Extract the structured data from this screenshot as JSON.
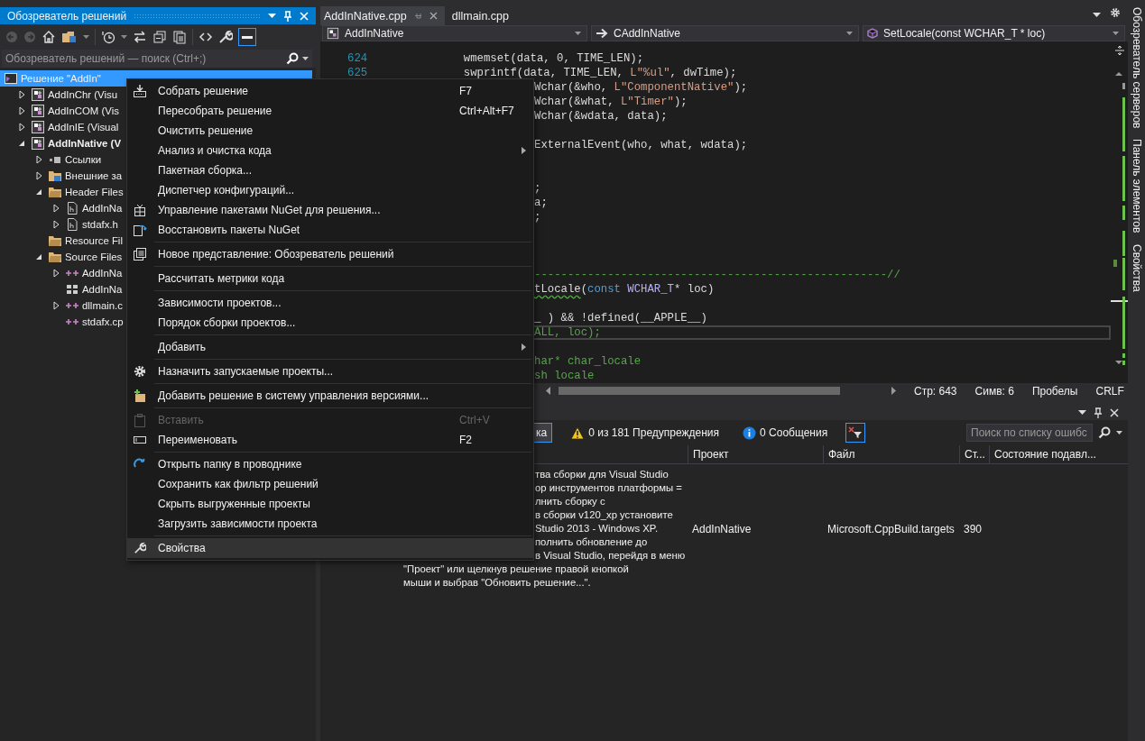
{
  "solution_explorer": {
    "title": "Обозреватель решений",
    "search": {
      "placeholder": "Обозреватель решений — поиск (Ctrl+;)"
    },
    "tree": [
      {
        "label": "Решение \"AddIn\"",
        "kind": "solution",
        "selected": true,
        "children": [
          {
            "label": "AddInChr (Visu",
            "kind": "project",
            "expanded": false,
            "startup": false,
            "selected": false
          },
          {
            "label": "AddInCOM (Vis",
            "kind": "project",
            "expanded": false,
            "startup": false,
            "selected": false
          },
          {
            "label": "AddInIE (Visual",
            "kind": "project",
            "expanded": false,
            "startup": false,
            "selected": false
          },
          {
            "label": "AddInNative (V",
            "kind": "project",
            "expanded": true,
            "startup": true,
            "selected": false,
            "children": [
              {
                "label": "Ссылки",
                "kind": "references",
                "expanded": false,
                "selected": false
              },
              {
                "label": "Внешние за",
                "kind": "external",
                "expanded": false,
                "selected": false
              },
              {
                "label": "Header Files",
                "kind": "folder",
                "expanded": true,
                "selected": false,
                "children": [
                  {
                    "label": "AddInNa",
                    "kind": "header",
                    "expanded": false,
                    "selected": false
                  },
                  {
                    "label": "stdafx.h",
                    "kind": "header",
                    "expanded": false,
                    "selected": false
                  }
                ]
              },
              {
                "label": "Resource Fil",
                "kind": "folder",
                "selected": false
              },
              {
                "label": "Source Files",
                "kind": "folder",
                "expanded": true,
                "selected": false,
                "children": [
                  {
                    "label": "AddInNa",
                    "kind": "cpp",
                    "expanded": false,
                    "selected": false
                  },
                  {
                    "label": "AddInNa",
                    "kind": "def",
                    "selected": false
                  },
                  {
                    "label": "dllmain.c",
                    "kind": "cpp",
                    "expanded": false,
                    "selected": false
                  },
                  {
                    "label": "stdafx.cp",
                    "kind": "cpp",
                    "selected": false
                  }
                ]
              }
            ]
          }
        ]
      }
    ]
  },
  "editor": {
    "tabs": [
      {
        "label": "AddInNative.cpp",
        "selected": true
      },
      {
        "label": "dllmain.cpp",
        "selected": false
      }
    ],
    "navigation": [
      {
        "label": "AddInNative",
        "kind": "project"
      },
      {
        "label": "CAddInNative",
        "kind": "class"
      },
      {
        "label": "SetLocale(const WCHAR_T * loc)",
        "kind": "method"
      }
    ],
    "lines": [
      {
        "kind": "numbered",
        "number": "624",
        "tokens": [
          {
            "text": "          wmemset(data, 0, TIME_LEN);",
            "kind": "plain"
          }
        ]
      },
      {
        "kind": "numbered",
        "number": "625",
        "tokens": [
          {
            "text": "          swprintf(data, TIME_LEN, ",
            "kind": "plain"
          },
          {
            "text": "L\"%ul\"",
            "kind": "string"
          },
          {
            "text": ", dwTime);",
            "kind": "plain"
          }
        ]
      },
      {
        "kind": "covered",
        "tokens": [
          {
            "text": "Wchar(&who, ",
            "kind": "plain"
          },
          {
            "text": "L\"ComponentNative\"",
            "kind": "string"
          },
          {
            "text": ");",
            "kind": "plain"
          }
        ]
      },
      {
        "kind": "covered",
        "tokens": [
          {
            "text": "Wchar(&what, ",
            "kind": "plain"
          },
          {
            "text": "L\"Timer\"",
            "kind": "string"
          },
          {
            "text": ");",
            "kind": "plain"
          }
        ]
      },
      {
        "kind": "covered",
        "tokens": [
          {
            "text": "Wchar(&wdata, data);",
            "kind": "plain"
          }
        ]
      },
      {
        "kind": "blank"
      },
      {
        "kind": "covered",
        "tokens": [
          {
            "text": "ExternalEvent(who, what, wdata);",
            "kind": "plain"
          }
        ]
      },
      {
        "kind": "blank"
      },
      {
        "kind": "blank"
      },
      {
        "kind": "covered",
        "tokens": [
          {
            "text": ";",
            "kind": "plain"
          }
        ]
      },
      {
        "kind": "covered",
        "tokens": [
          {
            "text": "a;",
            "kind": "plain"
          }
        ]
      },
      {
        "kind": "covered",
        "tokens": [
          {
            "text": ";",
            "kind": "plain"
          }
        ]
      },
      {
        "kind": "blank"
      },
      {
        "kind": "blank"
      },
      {
        "kind": "blank"
      },
      {
        "kind": "covered",
        "tokens": [
          {
            "text": "-----------------------------------------------------//",
            "kind": "comment"
          }
        ]
      },
      {
        "kind": "covered",
        "tokens": [
          {
            "text": "tLocale",
            "kind": "plain",
            "squiggle": true
          },
          {
            "text": "(",
            "kind": "plain"
          },
          {
            "text": "const",
            "kind": "keyword"
          },
          {
            "text": " WCHAR_T",
            "kind": "type"
          },
          {
            "text": "* loc)",
            "kind": "plain"
          }
        ]
      },
      {
        "kind": "blank"
      },
      {
        "kind": "covered",
        "tokens": [
          {
            "text": "_ ) && !defined(__APPLE__)",
            "kind": "plain"
          }
        ]
      },
      {
        "kind": "covered",
        "current": true,
        "tokens": [
          {
            "text": "ALL, loc);",
            "kind": "comment"
          }
        ]
      },
      {
        "kind": "blank"
      },
      {
        "kind": "covered",
        "tokens": [
          {
            "text": "har* char_locale",
            "kind": "comment"
          }
        ]
      },
      {
        "kind": "covered",
        "tokens": [
          {
            "text": "sh locale",
            "kind": "comment"
          }
        ]
      }
    ],
    "status": {
      "line": "Стр: 643",
      "column": "Симв: 6",
      "indent": "Пробелы",
      "line_endings": "CRLF"
    }
  },
  "context_menu": {
    "groups": [
      [
        {
          "label": "Собрать решение",
          "shortcut": "F7",
          "kind": "build",
          "selected": false,
          "disabled": false
        },
        {
          "label": "Пересобрать решение",
          "shortcut": "Ctrl+Alt+F7",
          "selected": false,
          "disabled": false
        },
        {
          "label": "Очистить решение",
          "selected": false,
          "disabled": false
        },
        {
          "label": "Анализ и очистка кода",
          "submenu": true,
          "selected": false,
          "disabled": false
        },
        {
          "label": "Пакетная сборка...",
          "selected": false,
          "disabled": false
        },
        {
          "label": "Диспетчер конфигураций...",
          "selected": false,
          "disabled": false
        },
        {
          "label": "Управление пакетами NuGet для решения...",
          "kind": "nuget",
          "selected": false,
          "disabled": false
        },
        {
          "label": "Восстановить пакеты NuGet",
          "kind": "restore",
          "selected": false,
          "disabled": false
        }
      ],
      [
        {
          "label": "Новое представление: Обозреватель решений",
          "kind": "view",
          "selected": false,
          "disabled": false
        }
      ],
      [
        {
          "label": "Рассчитать метрики кода",
          "selected": false,
          "disabled": false
        }
      ],
      [
        {
          "label": "Зависимости проектов...",
          "selected": false,
          "disabled": false
        },
        {
          "label": "Порядок сборки проектов...",
          "selected": false,
          "disabled": false
        }
      ],
      [
        {
          "label": "Добавить",
          "submenu": true,
          "selected": false,
          "disabled": false
        }
      ],
      [
        {
          "label": "Назначить запускаемые проекты...",
          "kind": "gear",
          "selected": false,
          "disabled": false
        }
      ],
      [
        {
          "label": "Добавить решение в систему управления версиями...",
          "kind": "vcs",
          "selected": false,
          "disabled": false
        }
      ],
      [
        {
          "label": "Вставить",
          "shortcut": "Ctrl+V",
          "kind": "paste",
          "selected": false,
          "disabled": true
        },
        {
          "label": "Переименовать",
          "shortcut": "F2",
          "kind": "rename",
          "selected": false,
          "disabled": false
        }
      ],
      [
        {
          "label": "Открыть папку в проводнике",
          "kind": "folder",
          "selected": false,
          "disabled": false
        },
        {
          "label": "Сохранить как фильтр решений",
          "selected": false,
          "disabled": false
        },
        {
          "label": "Скрыть выгруженные проекты",
          "selected": false,
          "disabled": false
        },
        {
          "label": "Загрузить зависимости проекта",
          "selected": false,
          "disabled": false
        }
      ],
      [
        {
          "label": "Свойства",
          "kind": "wrench",
          "selected": true,
          "disabled": false
        }
      ]
    ]
  },
  "error_list": {
    "filters": [
      {
        "label": "ка",
        "kind": "plain",
        "selected": true
      },
      {
        "label": "0 из 181 Предупреждения",
        "kind": "warning",
        "selected": false
      },
      {
        "label": "0 Сообщения",
        "kind": "info",
        "selected": false
      }
    ],
    "search": {
      "placeholder": "Поиск по списку ошибс"
    },
    "columns": [
      "Проект",
      "Файл",
      "Ст...",
      "Состояние подавл..."
    ],
    "rows": [
      {
        "description": [
          {
            "text": "тва сборки для Visual Studio",
            "kind": "covered"
          },
          {
            "text": "ор инструментов платформы =",
            "kind": "covered"
          },
          {
            "text": "лнить сборку с",
            "kind": "covered"
          },
          {
            "text": "в сборки v120_xp установите",
            "kind": "covered"
          },
          {
            "text": "Studio 2013 - Windows XP.",
            "kind": "covered"
          },
          {
            "text": "полнить обновление до",
            "kind": "covered"
          },
          {
            "text": "в Visual Studio, перейдя в меню",
            "kind": "covered"
          },
          {
            "text": "\"Проект\" или щелкнув решение правой кнопкой",
            "kind": "full"
          },
          {
            "text": "мыши и выбрав \"Обновить решение...\".",
            "kind": "full"
          }
        ],
        "project": "AddInNative",
        "file": "Microsoft.CppBuild.targets",
        "line": "390"
      }
    ]
  },
  "side_tabs": [
    "Обозреватель серверов",
    "Панель элементов",
    "Свойства"
  ]
}
